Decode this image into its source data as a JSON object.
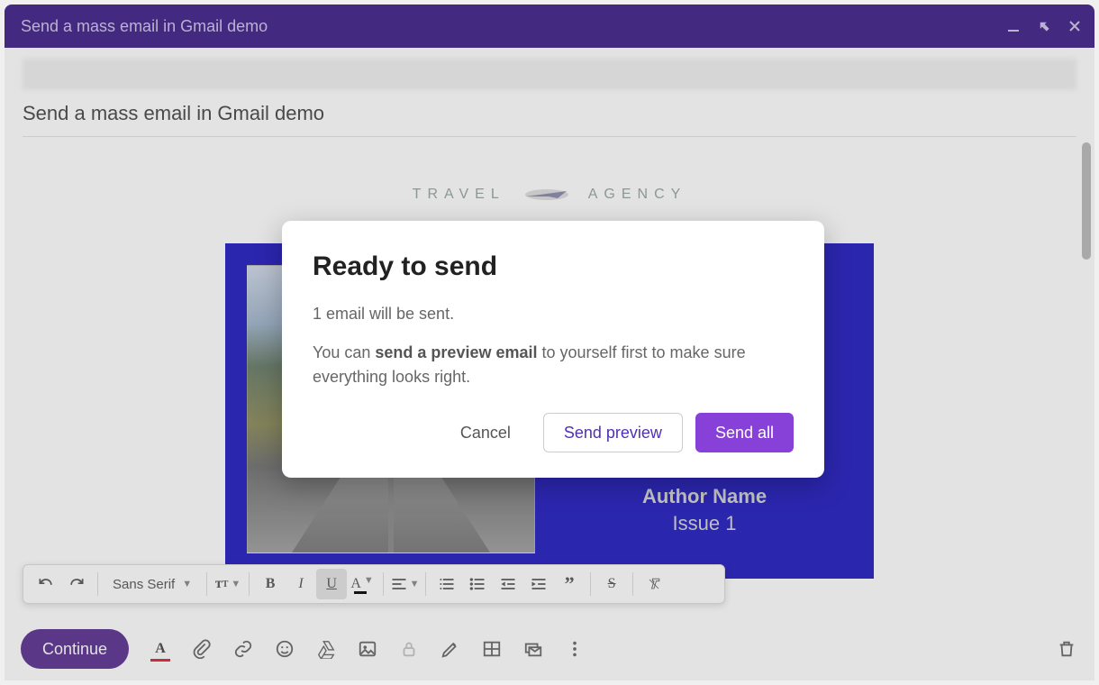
{
  "window": {
    "title": "Send a mass email in Gmail demo"
  },
  "compose": {
    "subject": "Send a mass email in Gmail demo",
    "brand_left": "TRAVEL",
    "brand_right": "AGENCY",
    "hero": {
      "author": "Author Name",
      "issue": "Issue 1"
    },
    "continue_label": "Continue"
  },
  "formatting": {
    "font": "Sans Serif"
  },
  "modal": {
    "title": "Ready to send",
    "line1": "1 email will be sent.",
    "line2_prefix": "You can ",
    "line2_bold": "send a preview email",
    "line2_suffix": " to yourself first to make sure everything looks right.",
    "cancel_label": "Cancel",
    "preview_label": "Send preview",
    "sendall_label": "Send all"
  }
}
